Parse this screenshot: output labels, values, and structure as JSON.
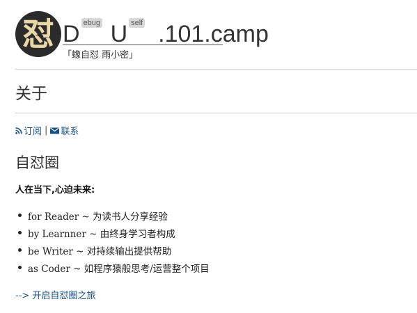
{
  "header": {
    "logo_char": "怼",
    "title": {
      "part1": "D",
      "sup1": "ebug",
      "part2": "U",
      "sup2": "self",
      "part3": ".101.camp"
    },
    "tagline": "「蟓自怼 雨小密」"
  },
  "page": {
    "title": "关于"
  },
  "links": {
    "subscribe": "订阅",
    "separator": "|",
    "contact": "联系"
  },
  "section": {
    "title": "自怼圈",
    "motto": "人在当下,心迫未来:",
    "items": [
      "for Reader ~ 为读书人分享经验",
      "by Learnner ~ 由终身学习者构成",
      "be Writer ~ 对持续输出提供帮助",
      "as Coder ~ 如程序猿般思考/运营整个项目"
    ],
    "start_link": "--> 开启自怼圈之旅"
  },
  "colors": {
    "link": "#15508a",
    "logo_bg": "#2b2b2b",
    "logo_fg": "#e9d8a6",
    "rule": "#cccccc"
  },
  "icons": [
    "rss-icon",
    "mail-icon"
  ]
}
